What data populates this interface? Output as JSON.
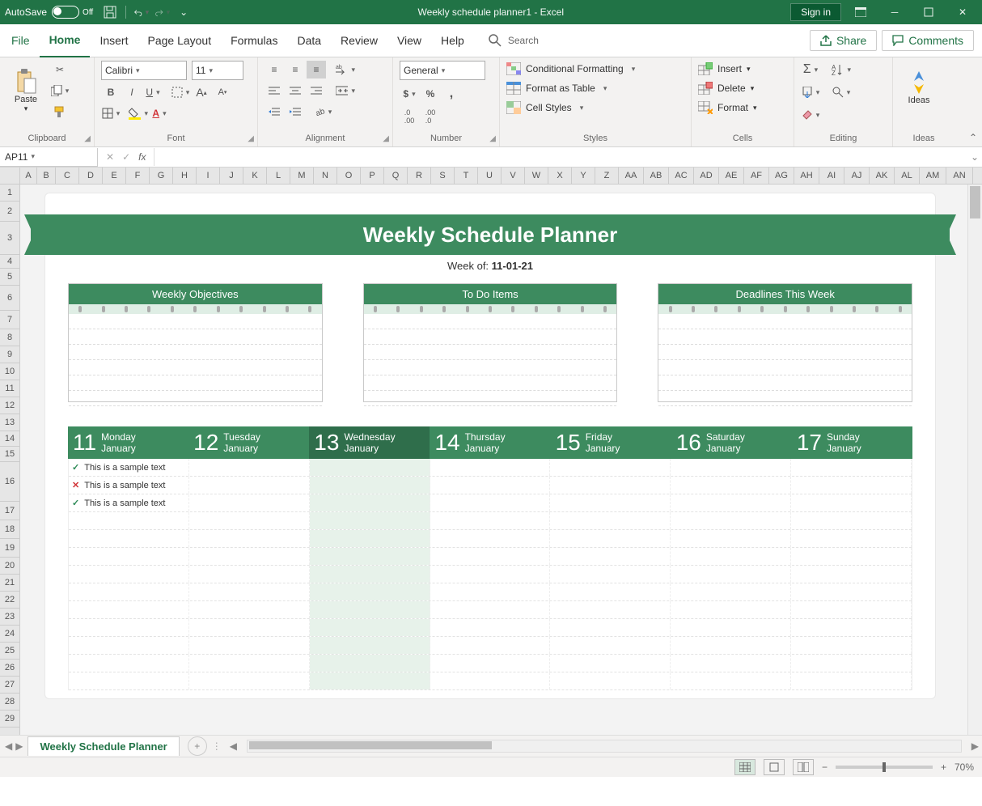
{
  "titlebar": {
    "autosave_label": "AutoSave",
    "autosave_state": "Off",
    "doc_title": "Weekly schedule planner1  -  Excel",
    "signin": "Sign in"
  },
  "menu": {
    "file": "File",
    "home": "Home",
    "insert": "Insert",
    "page_layout": "Page Layout",
    "formulas": "Formulas",
    "data": "Data",
    "review": "Review",
    "view": "View",
    "help": "Help",
    "search": "Search",
    "share": "Share",
    "comments": "Comments"
  },
  "ribbon": {
    "paste": "Paste",
    "clipboard": "Clipboard",
    "font_name": "Calibri",
    "font_size": "11",
    "font": "Font",
    "alignment": "Alignment",
    "number_format": "General",
    "number": "Number",
    "cond_fmt": "Conditional Formatting",
    "fmt_table": "Format as Table",
    "cell_styles": "Cell Styles",
    "styles": "Styles",
    "insert": "Insert",
    "delete": "Delete",
    "format": "Format",
    "cells": "Cells",
    "editing": "Editing",
    "ideas": "Ideas"
  },
  "namebox": "AP11",
  "columns": [
    "A",
    "B",
    "C",
    "D",
    "E",
    "F",
    "G",
    "H",
    "I",
    "J",
    "K",
    "L",
    "M",
    "N",
    "O",
    "P",
    "Q",
    "R",
    "S",
    "T",
    "U",
    "V",
    "W",
    "X",
    "Y",
    "Z",
    "AA",
    "AB",
    "AC",
    "AD",
    "AE",
    "AF",
    "AG",
    "AH",
    "AI",
    "AJ",
    "AK",
    "AL",
    "AM",
    "AN"
  ],
  "rows": [
    "1",
    "2",
    "3",
    "4",
    "5",
    "6",
    "7",
    "8",
    "9",
    "10",
    "11",
    "12",
    "13",
    "14",
    "15",
    "16",
    "17",
    "18",
    "19",
    "20",
    "21",
    "22",
    "23",
    "24",
    "25",
    "26",
    "27",
    "28",
    "29"
  ],
  "planner": {
    "title": "Weekly Schedule Planner",
    "week_of_label": "Week of:",
    "week_of_date": "11-01-21",
    "card1": "Weekly Objectives",
    "card2": "To Do Items",
    "card3": "Deadlines This Week",
    "days": [
      {
        "num": "11",
        "dow": "Monday",
        "mon": "January",
        "hl": false
      },
      {
        "num": "12",
        "dow": "Tuesday",
        "mon": "January",
        "hl": false
      },
      {
        "num": "13",
        "dow": "Wednesday",
        "mon": "January",
        "hl": true
      },
      {
        "num": "14",
        "dow": "Thursday",
        "mon": "January",
        "hl": false
      },
      {
        "num": "15",
        "dow": "Friday",
        "mon": "January",
        "hl": false
      },
      {
        "num": "16",
        "dow": "Saturday",
        "mon": "January",
        "hl": false
      },
      {
        "num": "17",
        "dow": "Sunday",
        "mon": "January",
        "hl": false
      }
    ],
    "items": [
      {
        "mark": "✓",
        "cls": "chk",
        "text": "This is a sample text"
      },
      {
        "mark": "✕",
        "cls": "x",
        "text": "This is a sample text"
      },
      {
        "mark": "✓",
        "cls": "chk",
        "text": "This is a sample text"
      }
    ]
  },
  "sheet_tab": "Weekly Schedule Planner",
  "zoom": "70%"
}
